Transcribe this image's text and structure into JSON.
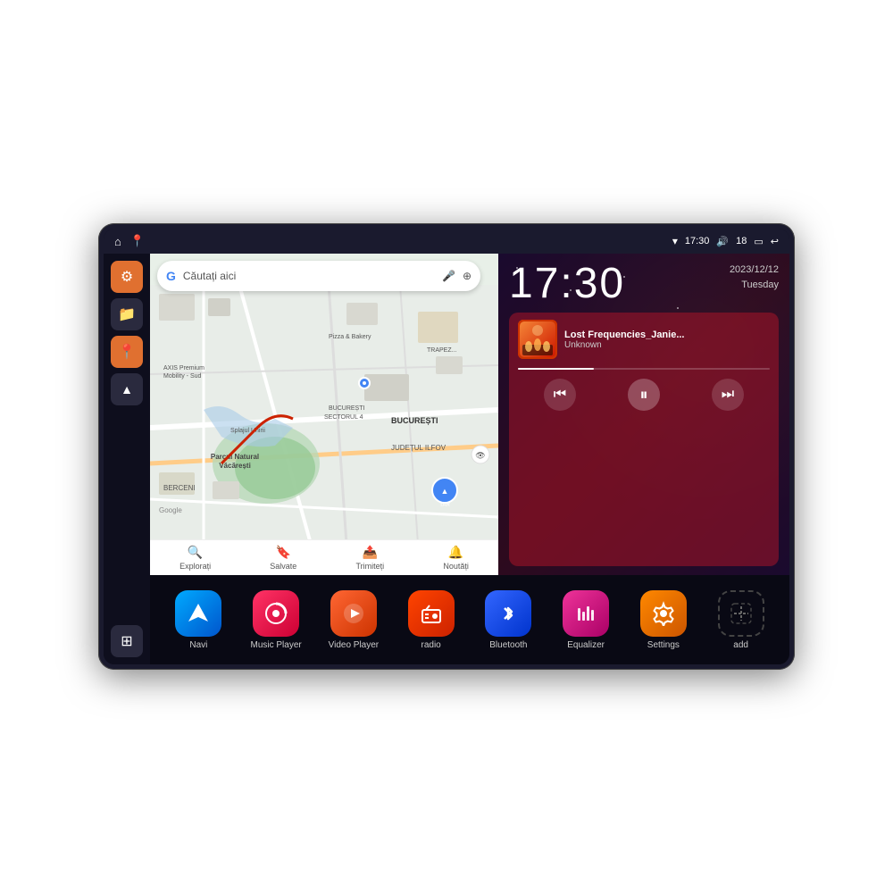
{
  "device": {
    "status_bar": {
      "wifi_icon": "▾",
      "time": "17:30",
      "volume_icon": "🔊",
      "battery_level": "18",
      "battery_icon": "▭",
      "back_icon": "↩",
      "home_icon": "⌂",
      "maps_icon": "📍"
    },
    "clock": {
      "time": "17:30",
      "date_line1": "2023/12/12",
      "date_line2": "Tuesday"
    },
    "music": {
      "title": "Lost Frequencies_Janie...",
      "artist": "Unknown",
      "album_art_emoji": "🎵"
    },
    "map": {
      "search_placeholder": "Căutați aici",
      "labels": [
        "Parcul Natural Văcărești",
        "BUCUREȘTI",
        "JUDEȚUL ILFOV",
        "BERCENI",
        "BUCUREȘTI SECTORUL 4",
        "AXIS Premium Mobility - Sud",
        "Pizza & Bakery",
        "TRAPEZU..."
      ],
      "bottom_items": [
        {
          "label": "Explorați",
          "icon": "🔍"
        },
        {
          "label": "Salvate",
          "icon": "🔖"
        },
        {
          "label": "Trimiteți",
          "icon": "📤"
        },
        {
          "label": "Noutăți",
          "icon": "🔔"
        }
      ]
    },
    "apps": [
      {
        "id": "navi",
        "label": "Navi",
        "icon": "▲",
        "color_class": "navi"
      },
      {
        "id": "music",
        "label": "Music Player",
        "icon": "♪",
        "color_class": "music"
      },
      {
        "id": "video",
        "label": "Video Player",
        "icon": "▶",
        "color_class": "video"
      },
      {
        "id": "radio",
        "label": "radio",
        "icon": "📻",
        "color_class": "radio"
      },
      {
        "id": "bluetooth",
        "label": "Bluetooth",
        "icon": "₿",
        "color_class": "bluetooth"
      },
      {
        "id": "equalizer",
        "label": "Equalizer",
        "icon": "≡",
        "color_class": "equalizer"
      },
      {
        "id": "settings",
        "label": "Settings",
        "icon": "⚙",
        "color_class": "settings"
      },
      {
        "id": "add",
        "label": "add",
        "icon": "+",
        "color_class": "add"
      }
    ],
    "sidebar": {
      "buttons": [
        {
          "id": "settings",
          "icon": "⚙",
          "type": "orange"
        },
        {
          "id": "folder",
          "icon": "📁",
          "type": "dark"
        },
        {
          "id": "maps",
          "icon": "📍",
          "type": "orange"
        },
        {
          "id": "nav",
          "icon": "▲",
          "type": "dark"
        },
        {
          "id": "grid",
          "icon": "⊞",
          "type": "grid"
        }
      ]
    }
  }
}
